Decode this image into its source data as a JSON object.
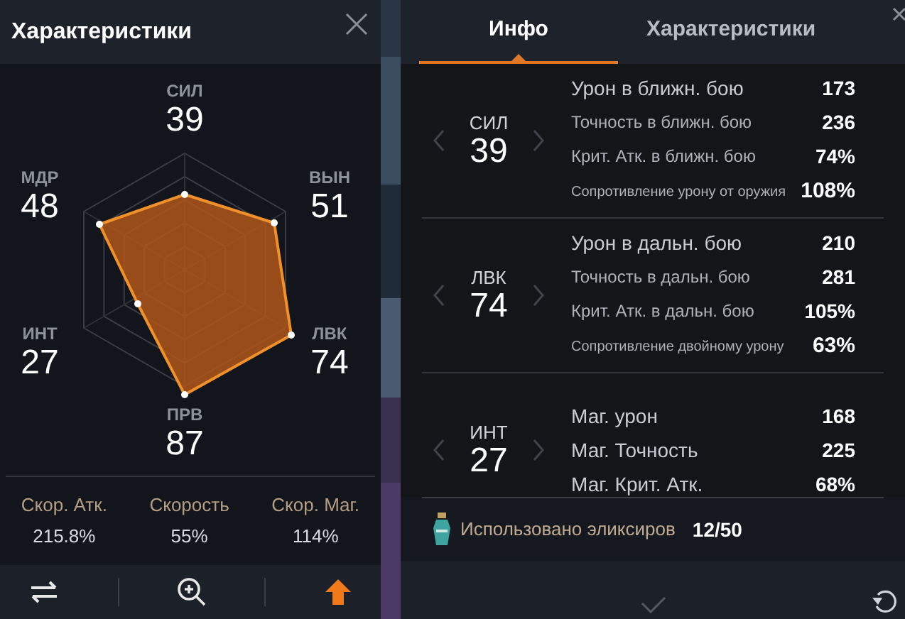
{
  "left_panel": {
    "title": "Характеристики",
    "stats": [
      {
        "label": "СИЛ",
        "value": "39"
      },
      {
        "label": "МДР",
        "value": "48"
      },
      {
        "label": "ВЫН",
        "value": "51"
      },
      {
        "label": "ИНТ",
        "value": "27"
      },
      {
        "label": "ЛВК",
        "value": "74"
      },
      {
        "label": "ПРВ",
        "value": "87"
      }
    ],
    "speeds": [
      {
        "label": "Скор. Атк.",
        "value": "215.8%"
      },
      {
        "label": "Скорость",
        "value": "55%"
      },
      {
        "label": "Скор. Маг.",
        "value": "114%"
      }
    ],
    "toolbar": [
      {
        "kind": "swap"
      },
      {
        "kind": "zoom"
      },
      {
        "kind": "upgrade"
      }
    ]
  },
  "right_panel": {
    "tabs": [
      {
        "label": "Инфо",
        "selected": true
      },
      {
        "label": "Характеристики",
        "selected": false
      }
    ],
    "sections": [
      {
        "label": "СИЛ",
        "value": "39",
        "rows": [
          {
            "kind": "main",
            "label": "Урон в ближн. бою",
            "value": "173"
          },
          {
            "kind": "sub",
            "label": "Точность в ближн. бою",
            "value": "236"
          },
          {
            "kind": "sub",
            "label": "Крит. Атк. в ближн. бою",
            "value": "74%"
          },
          {
            "kind": "small",
            "label": "Сопротивление урону от оружия",
            "value": "108%"
          }
        ]
      },
      {
        "label": "ЛВК",
        "value": "74",
        "rows": [
          {
            "kind": "main",
            "label": "Урон в дальн. бою",
            "value": "210"
          },
          {
            "kind": "sub",
            "label": "Точность в дальн. бою",
            "value": "281"
          },
          {
            "kind": "sub",
            "label": "Крит. Атк. в дальн. бою",
            "value": "105%"
          },
          {
            "kind": "small",
            "label": "Сопротивление двойному урону",
            "value": "63%"
          }
        ]
      },
      {
        "label": "ИНТ",
        "value": "27",
        "rows": [
          {
            "kind": "main",
            "label": "Маг. урон",
            "value": "168"
          },
          {
            "kind": "main",
            "label": "Маг. Точность",
            "value": "225"
          },
          {
            "kind": "main",
            "label": "Маг. Крит. Атк.",
            "value": "68%"
          }
        ]
      }
    ],
    "elixir": {
      "label": "Использовано эликсиров",
      "value": "12/50"
    }
  }
}
